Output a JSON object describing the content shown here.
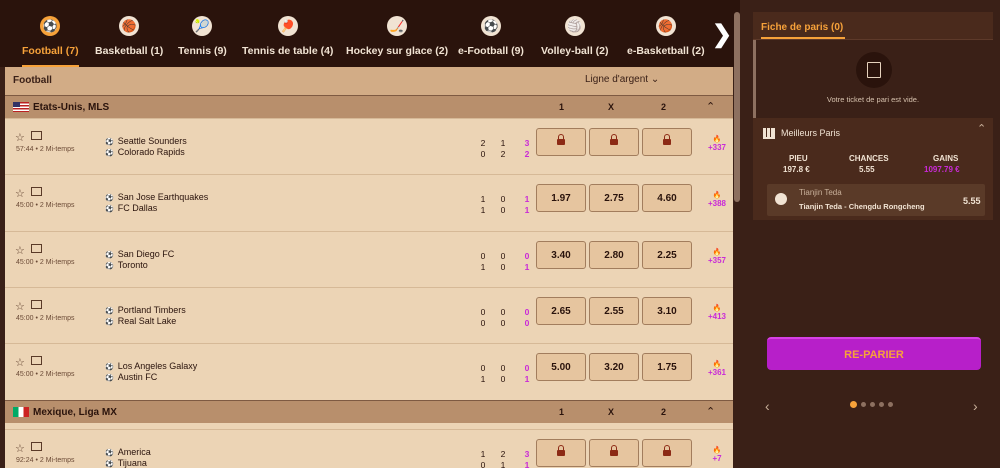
{
  "tabs": [
    {
      "label": "Football (7)",
      "icon": "football-icon",
      "glyph": "⚽"
    },
    {
      "label": "Basketball (1)",
      "icon": "basketball-icon",
      "glyph": "🏀"
    },
    {
      "label": "Tennis (9)",
      "icon": "tennis-icon",
      "glyph": "🎾"
    },
    {
      "label": "Tennis de table (4)",
      "icon": "table-tennis-icon",
      "glyph": "🏓"
    },
    {
      "label": "Hockey sur glace (2)",
      "icon": "ice-hockey-icon",
      "glyph": "🏒"
    },
    {
      "label": "e-Football (9)",
      "icon": "efootball-icon",
      "glyph": "⚽"
    },
    {
      "label": "Volley-ball (2)",
      "icon": "volleyball-icon",
      "glyph": "🏐"
    },
    {
      "label": "e-Basketball (2)",
      "icon": "ebasketball-icon",
      "glyph": "🏀"
    }
  ],
  "main": {
    "title": "Football",
    "line_select": "Ligne d'argent ⌄"
  },
  "leagues": [
    {
      "name": "Etats-Unis, MLS",
      "flag": "us",
      "h1": "1",
      "hx": "X",
      "h2": "2"
    },
    {
      "name": "Mexique, Liga MX",
      "flag": "mx",
      "h1": "1",
      "hx": "X",
      "h2": "2"
    }
  ],
  "matches": [
    {
      "team1": "Seattle Sounders",
      "team2": "Colorado Rapids",
      "time": "57:44 • 2 Mi-temps",
      "s1": [
        "2",
        "1",
        "3"
      ],
      "s2": [
        "0",
        "2",
        "2"
      ],
      "odds": [
        "lock",
        "lock",
        "lock"
      ],
      "more": "+337"
    },
    {
      "team1": "San Jose Earthquakes",
      "team2": "FC Dallas",
      "time": "45:00 • 2 Mi-temps",
      "s1": [
        "1",
        "0",
        "1"
      ],
      "s2": [
        "1",
        "0",
        "1"
      ],
      "odds": [
        "1.97",
        "2.75",
        "4.60"
      ],
      "more": "+388"
    },
    {
      "team1": "San Diego FC",
      "team2": "Toronto",
      "time": "45:00 • 2 Mi-temps",
      "s1": [
        "0",
        "0",
        "0"
      ],
      "s2": [
        "1",
        "0",
        "1"
      ],
      "odds": [
        "3.40",
        "2.80",
        "2.25"
      ],
      "more": "+357"
    },
    {
      "team1": "Portland Timbers",
      "team2": "Real Salt Lake",
      "time": "45:00 • 2 Mi-temps",
      "s1": [
        "0",
        "0",
        "0"
      ],
      "s2": [
        "0",
        "0",
        "0"
      ],
      "odds": [
        "2.65",
        "2.55",
        "3.10"
      ],
      "more": "+413"
    },
    {
      "team1": "Los Angeles Galaxy",
      "team2": "Austin FC",
      "time": "45:00 • 2 Mi-temps",
      "s1": [
        "0",
        "0",
        "0"
      ],
      "s2": [
        "1",
        "0",
        "1"
      ],
      "odds": [
        "5.00",
        "3.20",
        "1.75"
      ],
      "more": "+361"
    },
    {
      "team1": "America",
      "team2": "Tijuana",
      "time": "92:24 • 2 Mi-temps",
      "s1": [
        "1",
        "2",
        "3"
      ],
      "s2": [
        "0",
        "1",
        "1"
      ],
      "odds": [
        "lock",
        "lock",
        "lock"
      ],
      "more": "+7"
    }
  ],
  "betslip": {
    "title": "Fiche de paris (0)",
    "empty": "Votre ticket de pari est vide.",
    "best_title": "Meilleurs Paris",
    "col_stake": "PIEU",
    "col_chances": "CHANCES",
    "col_gains": "GAINS",
    "stake": "197.8 €",
    "chances": "5.55",
    "gains": "1097.79 €",
    "pick_name": "Tianjin Teda",
    "pick_event": "Tianjin Teda - Chengdu Rongcheng",
    "pick_odd": "5.55",
    "repari": "RE-PARIER",
    "prev": "‹",
    "next": "›"
  },
  "colors": {
    "accent": "#f7a23a",
    "purple": "#c92ad7"
  }
}
